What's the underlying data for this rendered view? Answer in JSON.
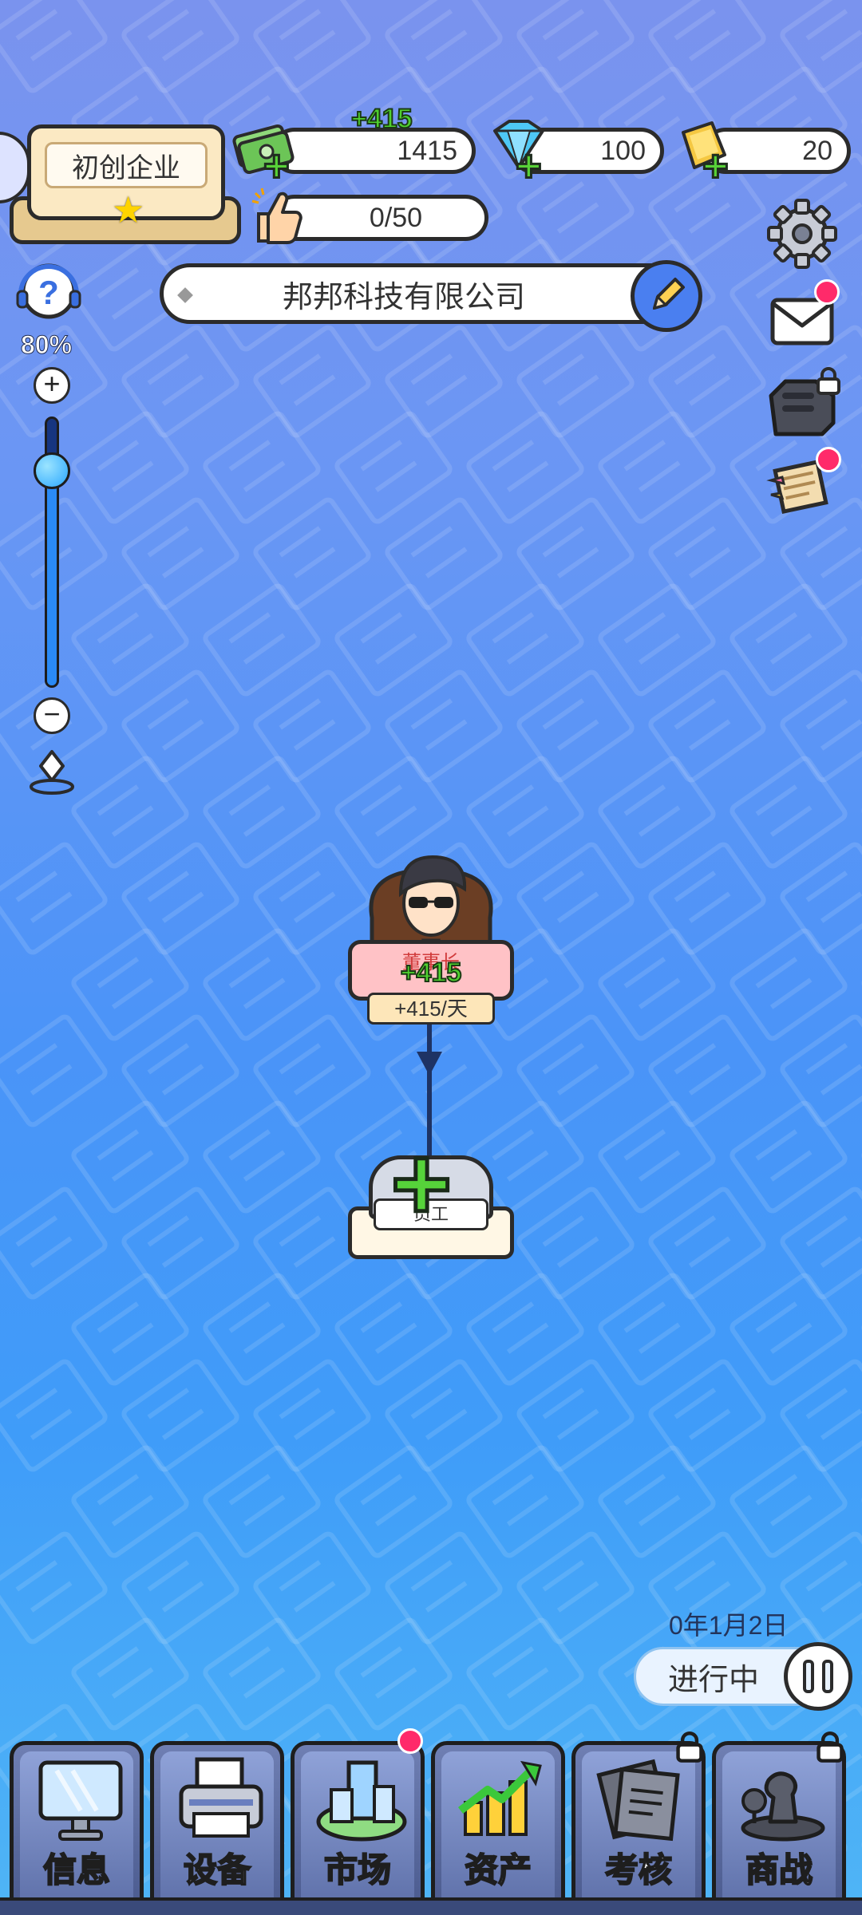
{
  "company_rank": {
    "label": "初创企业"
  },
  "resources": {
    "cash": {
      "value": "1415",
      "gain": "+415",
      "icon": "cash-icon"
    },
    "diamonds": {
      "value": "100",
      "icon": "diamond-icon"
    },
    "gold": {
      "value": "20",
      "icon": "gold-bar-icon"
    },
    "likes": {
      "value": "0/50",
      "icon": "thumbs-up-icon"
    }
  },
  "company_name": "邦邦科技有限公司",
  "zoom": {
    "percent_label": "80%",
    "level": 0.8,
    "zoom_in": "+",
    "zoom_out": "−"
  },
  "org": {
    "ceo": {
      "title": "董事长",
      "gain": "+415",
      "rate": "+415/天"
    },
    "employee_slot": {
      "label": "员工"
    }
  },
  "game_date": "0年1月2日",
  "status": "进行中",
  "nav": [
    {
      "label": "信息",
      "icon": "monitor-icon",
      "badge": false,
      "locked": false
    },
    {
      "label": "设备",
      "icon": "printer-icon",
      "badge": false,
      "locked": false
    },
    {
      "label": "市场",
      "icon": "city-icon",
      "badge": true,
      "locked": false
    },
    {
      "label": "资产",
      "icon": "growth-chart-icon",
      "badge": false,
      "locked": false
    },
    {
      "label": "考核",
      "icon": "documents-icon",
      "badge": false,
      "locked": true
    },
    {
      "label": "商战",
      "icon": "chess-icon",
      "badge": false,
      "locked": true
    }
  ],
  "colors": {
    "badge": "#ff2a6a",
    "plus_green": "#56d33a",
    "nav_bg": "#4a5a8e"
  }
}
